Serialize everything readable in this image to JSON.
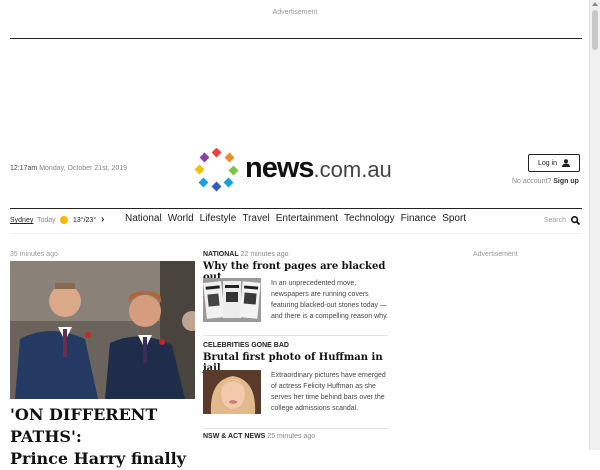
{
  "ad_label": "Advertisement",
  "header": {
    "time": "12:17am",
    "date": "Monday, October 21st, 2019",
    "logo_main": "news",
    "logo_suffix": ".com.au",
    "login_label": "Log in",
    "no_account": "No account?",
    "signup_label": "Sign up"
  },
  "nav": {
    "city": "Sydney",
    "today": "Today",
    "temps": "13°/23°",
    "items": [
      "National",
      "World",
      "Lifestyle",
      "Travel",
      "Entertainment",
      "Technology",
      "Finance",
      "Sport"
    ],
    "search_label": "Search"
  },
  "feature": {
    "time": "35 minutes ago",
    "headline_line1": "'ON DIFFERENT PATHS':",
    "headline_line2": "Prince Harry finally"
  },
  "stories": [
    {
      "kicker": "NATIONAL",
      "time": "22 minutes ago",
      "title": "Why the front pages are blacked out",
      "summary": "In an unprecedented move, newspapers are running covers featuring blacked-out stories today — and there is a compelling reason why."
    },
    {
      "kicker": "CELEBRITIES GONE BAD",
      "time": "",
      "title": "Brutal first photo of Huffman in jail",
      "summary": "Extraordinary pictures have emerged of actress Felicity Huffman as she serves her time behind bars over the college admissions scandal."
    },
    {
      "kicker": "NSW & ACT NEWS",
      "time": "25 minutes ago",
      "title": "",
      "summary": ""
    }
  ],
  "ad_right_label": "Advertisement",
  "colors": {
    "logo_dots": [
      "#e8423f",
      "#f08a24",
      "#7dc242",
      "#1a9fe0",
      "#2f5fb8",
      "#8b3fa8",
      "#e8423f",
      "#f2c200"
    ],
    "weather_sun": "#f6b800"
  }
}
